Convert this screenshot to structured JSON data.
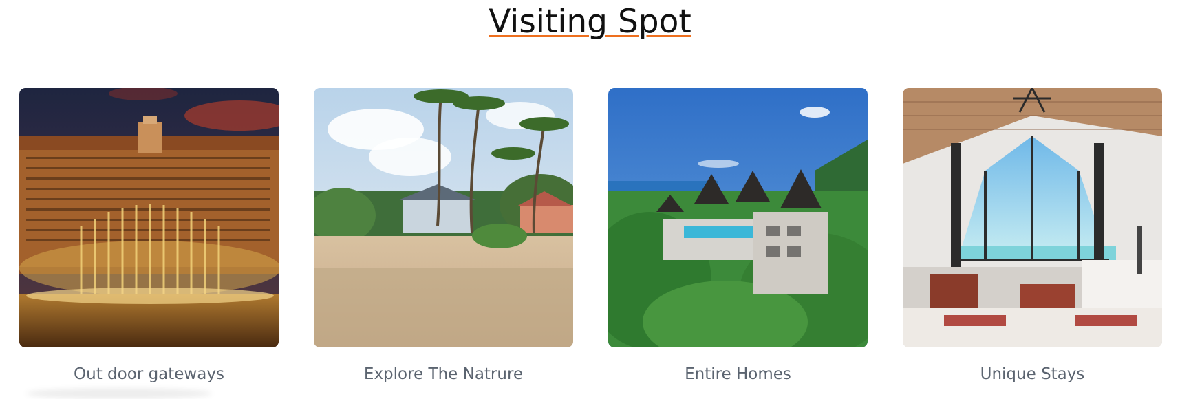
{
  "section": {
    "title": "Visiting Spot",
    "accent_color": "#ee6f1e"
  },
  "cards": [
    {
      "caption": "Out door gateways",
      "image": "hotel-fountain-night"
    },
    {
      "caption": "Explore The Natrure",
      "image": "beach-palms-houses"
    },
    {
      "caption": "Entire Homes",
      "image": "hillside-villa-pool"
    },
    {
      "caption": "Unique Stays",
      "image": "open-living-room-sea-view"
    }
  ]
}
